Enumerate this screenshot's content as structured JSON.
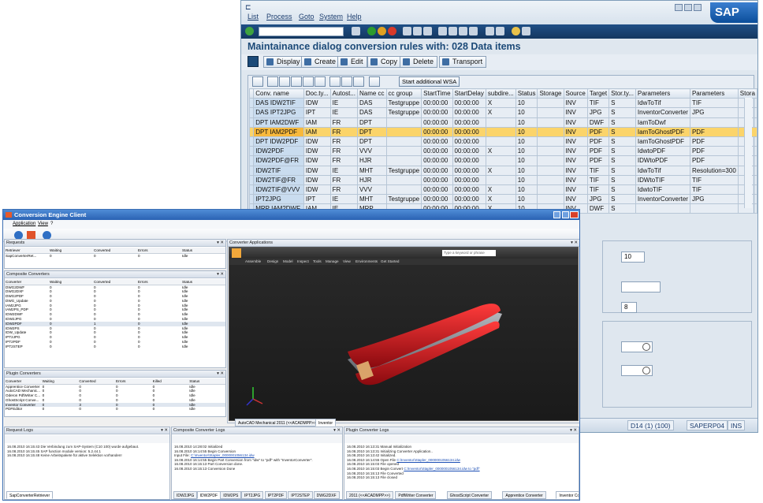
{
  "sap": {
    "menu": [
      "List",
      "Process",
      "Goto",
      "System",
      "Help"
    ],
    "logo": "SAP",
    "title": "Maintainance dialog conversion rules with: 028 Data items",
    "buttons": [
      "Display",
      "Create",
      "Edit",
      "Copy",
      "Delete",
      "Transport"
    ],
    "wsa_button": "Start additional WSA",
    "columns": [
      "Conv. name",
      "Doc.ty...",
      "Autost...",
      "Name cc",
      "cc group",
      "StartTime",
      "StartDelay",
      "subdire...",
      "Status",
      "Storage",
      "Source",
      "Target",
      "Stor.ty...",
      "Parameters",
      "Parameters",
      "Stora"
    ],
    "rows": [
      [
        "DAS IDW2TIF",
        "IDW",
        "IE",
        "DAS",
        "Testgruppe",
        "00:00:00",
        "00:00:00",
        "X",
        "10",
        "",
        "INV",
        "TIF",
        "S",
        "IdwToTif",
        "TIF",
        ""
      ],
      [
        "DAS IPT2JPG",
        "IPT",
        "IE",
        "DAS",
        "Testgruppe",
        "00:00:00",
        "00:00:00",
        "X",
        "10",
        "",
        "INV",
        "JPG",
        "S",
        "InventorConverter",
        "JPG",
        ""
      ],
      [
        "DPT IAM2DWF",
        "IAM",
        "FR",
        "DPT",
        "",
        "00:00:00",
        "00:00:00",
        "",
        "10",
        "",
        "INV",
        "DWF",
        "S",
        "IamToDwf",
        "",
        ""
      ],
      [
        "DPT IAM2PDF",
        "IAM",
        "FR",
        "DPT",
        "",
        "00:00:00",
        "00:00:00",
        "",
        "10",
        "",
        "INV",
        "PDF",
        "S",
        "IamToGhostPDF",
        "PDF",
        ""
      ],
      [
        "DPT IDW2PDF",
        "IDW",
        "FR",
        "DPT",
        "",
        "00:00:00",
        "00:00:00",
        "",
        "10",
        "",
        "INV",
        "PDF",
        "S",
        "IamToGhostPDF",
        "PDF",
        ""
      ],
      [
        "IDW2PDF",
        "IDW",
        "FR",
        "VVV",
        "",
        "00:00:00",
        "00:00:00",
        "X",
        "10",
        "",
        "INV",
        "PDF",
        "S",
        "IdwtoPDF",
        "PDF",
        ""
      ],
      [
        "IDW2PDF@FR",
        "IDW",
        "FR",
        "HJR",
        "",
        "00:00:00",
        "00:00:00",
        "",
        "10",
        "",
        "INV",
        "PDF",
        "S",
        "IDWtoPDF",
        "PDF",
        ""
      ],
      [
        "IDW2TIF",
        "IDW",
        "IE",
        "MHT",
        "Testgruppe",
        "00:00:00",
        "00:00:00",
        "X",
        "10",
        "",
        "INV",
        "TIF",
        "S",
        "IdwToTif",
        "Resolution=300",
        ""
      ],
      [
        "IDW2TIF@FR",
        "IDW",
        "FR",
        "HJR",
        "",
        "00:00:00",
        "00:00:00",
        "",
        "10",
        "",
        "INV",
        "TIF",
        "S",
        "IDWtoTIF",
        "TIF",
        ""
      ],
      [
        "IDW2TIF@VVV",
        "IDW",
        "FR",
        "VVV",
        "",
        "00:00:00",
        "00:00:00",
        "X",
        "10",
        "",
        "INV",
        "TIF",
        "S",
        "IdwtoTIF",
        "TIF",
        ""
      ],
      [
        "IPT2JPG",
        "IPT",
        "IE",
        "MHT",
        "Testgruppe",
        "00:00:00",
        "00:00:00",
        "X",
        "10",
        "",
        "INV",
        "JPG",
        "S",
        "InventorConverter",
        "JPG",
        ""
      ],
      [
        "MRP IAM2DWF",
        "IAM",
        "IE",
        "MRP",
        "",
        "00:00:00",
        "00:00:00",
        "X",
        "10",
        "",
        "INV",
        "DWF",
        "S",
        "",
        "",
        ""
      ]
    ],
    "fields": [
      "10",
      "8"
    ],
    "status": [
      "D14 (1) (100)",
      "SAPERP04",
      "INS"
    ]
  },
  "cec": {
    "title": "Conversion Engine Client",
    "menu": [
      "Application",
      "View",
      "?"
    ],
    "requests": {
      "title": "Requests",
      "columns": [
        "Retriever",
        "Waiting",
        "Converted",
        "Errors",
        "Status"
      ],
      "rows": [
        [
          "SapConverterRet...",
          "0",
          "0",
          "0",
          "Idle"
        ]
      ]
    },
    "composite": {
      "title": "Composite Converters",
      "columns": [
        "Converter",
        "Waiting",
        "Converted",
        "Errors",
        "Status"
      ],
      "rows": [
        [
          "DWG2DWF",
          "0",
          "0",
          "0",
          "Idle"
        ],
        [
          "DWG2DXF",
          "0",
          "0",
          "0",
          "Idle"
        ],
        [
          "DWG2PDF",
          "0",
          "0",
          "0",
          "Idle"
        ],
        [
          "DWG_Update",
          "0",
          "0",
          "0",
          "Idle"
        ],
        [
          "IAM2JPG",
          "0",
          "0",
          "0",
          "Idle"
        ],
        [
          "IAM2PS_PDP",
          "0",
          "0",
          "0",
          "Idle"
        ],
        [
          "IDW2DWF",
          "0",
          "0",
          "0",
          "Idle"
        ],
        [
          "IDW2JPG",
          "0",
          "0",
          "0",
          "Idle"
        ],
        [
          "IDW2PDF",
          "0",
          "1",
          "0",
          "Idle"
        ],
        [
          "IDW2PS",
          "0",
          "0",
          "0",
          "Idle"
        ],
        [
          "IDW_Update",
          "0",
          "0",
          "0",
          "Idle"
        ],
        [
          "IPT2JPG",
          "0",
          "0",
          "0",
          "Idle"
        ],
        [
          "IPT2PDF",
          "0",
          "0",
          "0",
          "Idle"
        ],
        [
          "IPT2STEP",
          "0",
          "0",
          "0",
          "Idle"
        ]
      ]
    },
    "plugin": {
      "title": "Plugin Converters",
      "columns": [
        "Converter",
        "Waiting",
        "Converted",
        "Errors",
        "Killed",
        "Status"
      ],
      "rows": [
        [
          "Apprentice Converter",
          "0",
          "0",
          "0",
          "0",
          "Idle"
        ],
        [
          "AutoCAD Mechanic...",
          "0",
          "0",
          "0",
          "0",
          "Idle"
        ],
        [
          "Oderon PdfWriter C...",
          "0",
          "0",
          "0",
          "0",
          "Idle"
        ],
        [
          "GhostScript Conve...",
          "0",
          "0",
          "0",
          "0",
          "Idle"
        ],
        [
          "Inventor Converter",
          "0",
          "3",
          "0",
          "0",
          "Idle"
        ],
        [
          "PDFEditor",
          "0",
          "0",
          "0",
          "0",
          "Idle"
        ]
      ]
    },
    "viewer": {
      "title": "Converter Applications",
      "search_placeholder": "Type a keyword or phrase",
      "ribbon": [
        "Assemble",
        "Design",
        "Model",
        "Inspect",
        "Tools",
        "Manage",
        "View",
        "Environments",
        "Get Started"
      ],
      "tabs": [
        "AutoCAD Mechanical 2011 (<<ACADMPP>>)",
        "Inventor"
      ]
    },
    "request_logs": {
      "title": "Request Logs",
      "lines": [
        "16.08.2010 16:15:43  Die Verbindung zum SAP-System (C10 100) wurde aufgebaut.",
        "16.08.2010 16:15:45  SAP function module version: 5.2.44.1",
        "16.08.2010 16:15:48  Keine Arbeitspakete für aktive Selektion vorhanden!"
      ],
      "tab": "SapConverterRetriever"
    },
    "composite_logs": {
      "title": "Composite Converter Logs",
      "lines": [
        [
          "16.08.2010 14:28:02  Initialized",
          ""
        ],
        [
          "16.08.2010 16:14:55  Begin Conversion",
          ""
        ],
        [
          "                     Input File: ",
          "C:\\Inventor\\Stapler_0000001056134.idw"
        ],
        [
          "16.08.2010 16:14:55  Begin Part Conversion from \"idw\" to \"pdf\" with \"InventorConverter\".",
          ""
        ],
        [
          "16.08.2010 16:15:13     Part Conversion done.",
          ""
        ],
        [
          "16.08.2010 16:15:13  Conversion Done",
          ""
        ]
      ],
      "tabs": [
        "IDW2JPG",
        "IDW2PDF",
        "IDW2PS",
        "IPT2JPG",
        "IPT2PDF",
        "IPT2STEP",
        "DWG2DXF"
      ]
    },
    "plugin_logs": {
      "title": "Plugin Converter Logs",
      "lines": [
        [
          "16.08.2010 16:13:31  Manual Initialization",
          ""
        ],
        [
          "16.08.2010 16:13:31  Initializing Converter Application..",
          ""
        ],
        [
          "16.08.2010 16:13:42  Initialized.",
          ""
        ],
        [
          "16.08.2010 16:14:55  Open File ",
          "C:\\Inventor\\Stapler_0000001056134.idw"
        ],
        [
          "16.08.2010 16:15:03     File opened",
          ""
        ],
        [
          "16.08.2010 16:15:03     Begin Convert ",
          "C:\\Inventor\\Stapler_0000001056134.idw to \"pdf\""
        ],
        [
          "16.08.2010 16:15:13     File Converted",
          ""
        ],
        [
          "16.08.2010 16:15:13  File closed",
          ""
        ]
      ],
      "tabs": [
        "2011 (<<ACADMPP>>)",
        "PdfWriter Converter",
        "GhostScript Converter",
        "Apprentice Converter",
        "Inventor Converter"
      ]
    }
  },
  "colors": {
    "sap_selected_row": "#fbd46a",
    "sap_key_col": "#c9dcef",
    "cec_title": "#2a62b3",
    "stapler_red": "#c0141a"
  }
}
